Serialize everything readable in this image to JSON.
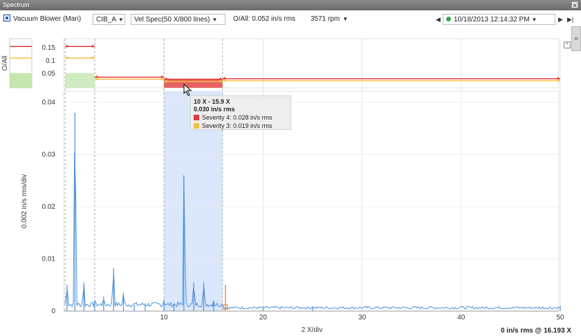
{
  "window": {
    "title": "Spectrum",
    "close": "✕"
  },
  "toolbar": {
    "machine": "Vacuum Blower (Man)",
    "point": "CIB_A",
    "spectrum": "Vel Spec(50 X/800 lines)",
    "overall": "O/All: 0.052 in/s rms",
    "rpm": "3571 rpm",
    "date": "10/18/2013 12:14:32 PM",
    "prev": "◀",
    "next": "▶",
    "end": "▶|",
    "collapse": "«"
  },
  "colors": {
    "line": "#4a90d9",
    "severity4": "#e03b3b",
    "severity3": "#f5c04a",
    "band": "#dbe7fb",
    "ok": "#c6e6b0"
  },
  "chart_data": {
    "type": "line",
    "xlabel": "2 X/div",
    "ylabel": "0.002 in/s rms/div",
    "x_ticks": [
      10,
      20,
      30,
      40,
      50
    ],
    "y_ticks": [
      "0.01",
      "0.02",
      "0.03",
      "0.04"
    ],
    "xlim": [
      0,
      50
    ],
    "ylim": [
      0,
      0.04
    ],
    "peaks": [
      {
        "x": 0.2,
        "y": 0.005
      },
      {
        "x": 1.0,
        "y": 0.038
      },
      {
        "x": 1.9,
        "y": 0.0055
      },
      {
        "x": 3.0,
        "y": 0.002
      },
      {
        "x": 3.9,
        "y": 0.0028
      },
      {
        "x": 4.9,
        "y": 0.0082
      },
      {
        "x": 5.9,
        "y": 0.0035
      },
      {
        "x": 7.0,
        "y": 0.0012
      },
      {
        "x": 8.1,
        "y": 0.0015
      },
      {
        "x": 10.0,
        "y": 0.0022
      },
      {
        "x": 11.0,
        "y": 0.0015
      },
      {
        "x": 12.0,
        "y": 0.026
      },
      {
        "x": 13.0,
        "y": 0.0055
      },
      {
        "x": 14.0,
        "y": 0.0055
      },
      {
        "x": 15.0,
        "y": 0.002
      },
      {
        "x": 20.0,
        "y": 0.0007
      },
      {
        "x": 25.0,
        "y": 0.0009
      },
      {
        "x": 50.0,
        "y": 0.001
      }
    ],
    "selected_band": {
      "from": 10,
      "to": 15.9
    },
    "cursor_x": 16.193,
    "overall_panel": {
      "ylabel": "O/All",
      "y_ticks": [
        "0.05",
        "0.1",
        "0.15"
      ],
      "ylim": [
        0,
        0.18
      ],
      "bands": [
        {
          "from": 0,
          "to": 3,
          "severity4": 0.155,
          "severity3": 0.11,
          "value": 0.052
        },
        {
          "from": 3,
          "to": 10,
          "severity4": 0.036,
          "severity3": 0.028,
          "value": 0
        },
        {
          "from": 10,
          "to": 15.9,
          "severity4": 0.028,
          "severity3": 0.019,
          "value": 0.03
        },
        {
          "from": 15.9,
          "to": 50,
          "severity4": 0.03,
          "severity3": 0.022,
          "value": 0
        }
      ]
    }
  },
  "tooltip": {
    "range": "10 X - 15.9 X",
    "value": "0.030 in/s rms",
    "sev4": "Severity 4: 0.028 in/s rms",
    "sev3": "Severity 3: 0.019 in/s rms"
  },
  "footer": "0 in/s rms @ 16.193 X"
}
